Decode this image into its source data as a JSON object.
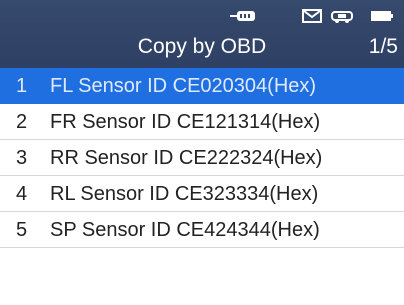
{
  "header": {
    "title": "Copy by OBD",
    "page_indicator": "1/5",
    "status_icons": [
      "obd-connector-icon",
      "message-icon",
      "vehicle-icon",
      "battery-icon"
    ]
  },
  "colors": {
    "header_bg": "#364a6d",
    "selected_row_bg": "#1f6fe0",
    "divider": "#d8d8d8",
    "text": "#222222"
  },
  "list": {
    "selected_index": 0,
    "items": [
      {
        "number": "1",
        "label": "FL Sensor ID CE020304(Hex)"
      },
      {
        "number": "2",
        "label": "FR Sensor ID CE121314(Hex)"
      },
      {
        "number": "3",
        "label": "RR Sensor ID CE222324(Hex)"
      },
      {
        "number": "4",
        "label": "RL Sensor ID CE323334(Hex)"
      },
      {
        "number": "5",
        "label": "SP Sensor ID CE424344(Hex)"
      }
    ]
  }
}
